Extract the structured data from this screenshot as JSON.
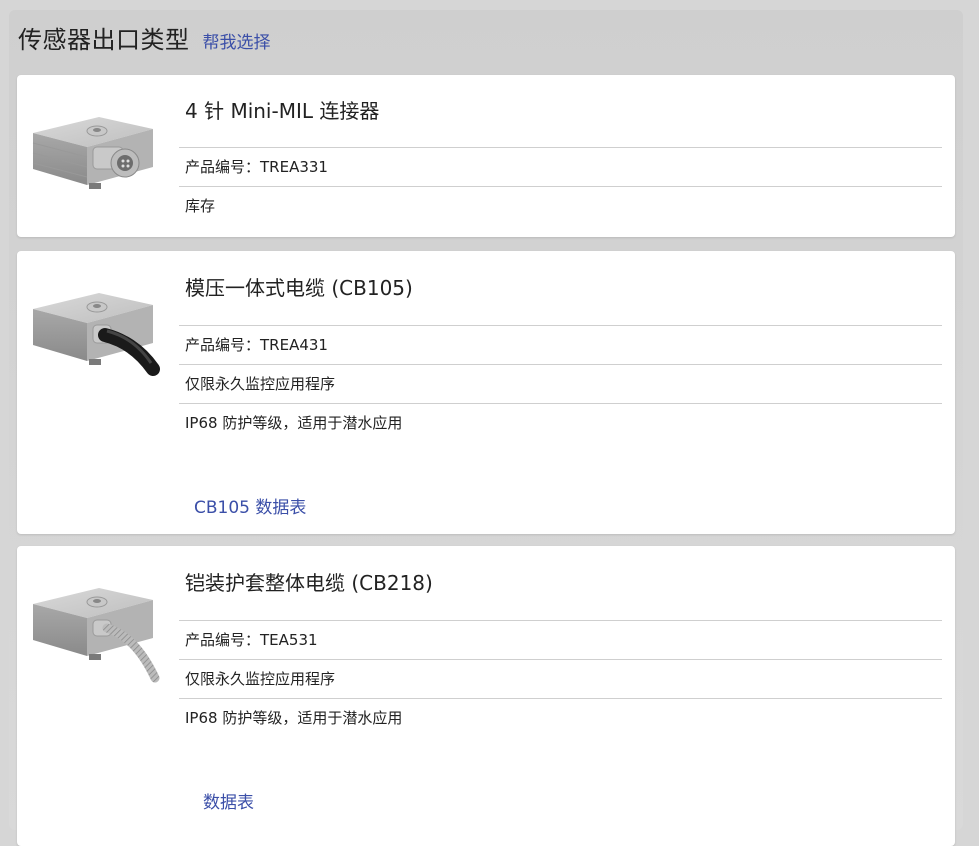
{
  "header": {
    "title": "传感器出口类型",
    "help_link": "帮我选择"
  },
  "products": [
    {
      "title": "4 针 Mini-MIL 连接器",
      "part_number": "产品编号：TREA331",
      "features": [
        "库存"
      ],
      "link": ""
    },
    {
      "title": "模压一体式电缆 (CB105)",
      "part_number": "产品编号：TREA431",
      "features": [
        "仅限永久监控应用程序",
        "IP68 防护等级，适用于潜水应用"
      ],
      "link": "CB105 数据表"
    },
    {
      "title": "铠装护套整体电缆 (CB218)",
      "part_number": "产品编号：TEA531",
      "features": [
        "仅限永久监控应用程序",
        "IP68 防护等级，适用于潜水应用"
      ],
      "link": "数据表"
    }
  ],
  "colors": {
    "link": "#3b4fa8",
    "background": "#d6d6d6",
    "card": "#ffffff"
  }
}
